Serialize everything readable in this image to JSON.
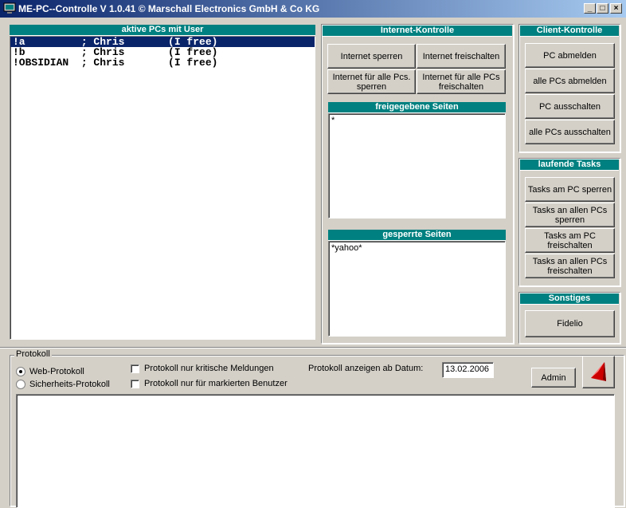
{
  "window": {
    "title": "ME-PC--Controlle V 1.0.41 © Marschall Electronics GmbH & Co KG",
    "minimize_glyph": "_",
    "maximize_glyph": "□",
    "close_glyph": "×"
  },
  "pcs": {
    "header": "aktive PCs mit User",
    "rows": [
      "!a         ; Chris       (I free)",
      "!b         ; Chris       (I free)",
      "!OBSIDIAN  ; Chris       (I free)"
    ]
  },
  "internet": {
    "header": "Internet-Kontrolle",
    "buttons": {
      "sperren": "Internet sperren",
      "freischalten": "Internet freischalten",
      "alle_sperren": "Internet für alle Pcs. sperren",
      "alle_freischalten": "Internet für alle PCs freischalten"
    },
    "free_header": "freigegebene Seiten",
    "free_pages": [
      "*"
    ],
    "blocked_header": "gesperrte Seiten",
    "blocked_pages": [
      "*yahoo*"
    ]
  },
  "client": {
    "header": "Client-Kontrolle",
    "buttons": [
      "PC abmelden",
      "alle PCs abmelden",
      "PC ausschalten",
      "alle PCs ausschalten"
    ]
  },
  "tasks": {
    "header": "laufende Tasks",
    "buttons": [
      "Tasks am PC sperren",
      "Tasks an allen PCs sperren",
      "Tasks am PC freischalten",
      "Tasks an allen PCs freischalten"
    ]
  },
  "misc": {
    "header": "Sonstiges",
    "button": "Fidelio"
  },
  "protokoll": {
    "legend": "Protokoll",
    "radio_web": "Web-Protokoll",
    "radio_security": "Sicherheits-Protokoll",
    "selected_radio": "web",
    "check_critical": "Protokoll nur kritische Meldungen",
    "check_marked": "Protokoll nur für markierten Benutzer",
    "date_label": "Protokoll anzeigen ab Datum:",
    "date_value": "13.02.2006",
    "admin_label": "Admin"
  },
  "colors": {
    "header_teal": "#008080",
    "selection": "#0a246a",
    "logo_red": "#cc0000"
  }
}
